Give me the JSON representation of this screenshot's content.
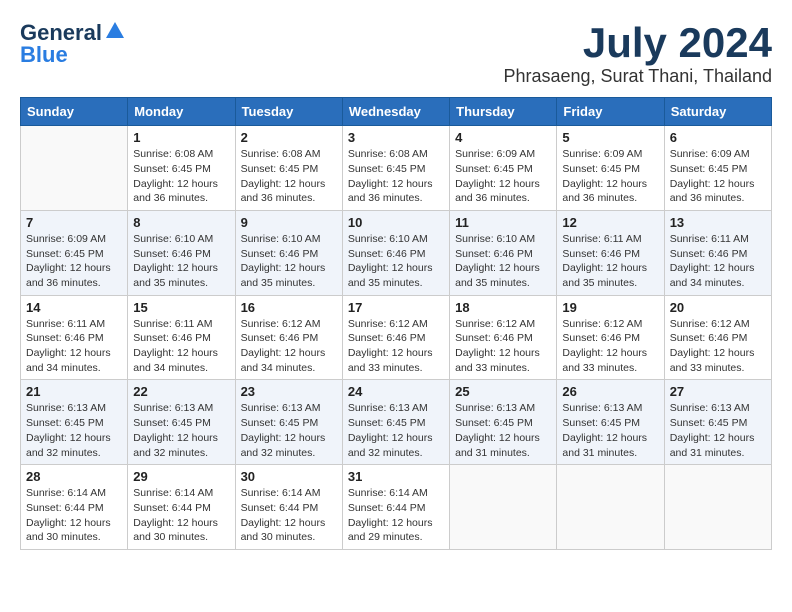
{
  "header": {
    "logo_line1": "General",
    "logo_line2": "Blue",
    "month": "July 2024",
    "location": "Phrasaeng, Surat Thani, Thailand"
  },
  "days_of_week": [
    "Sunday",
    "Monday",
    "Tuesday",
    "Wednesday",
    "Thursday",
    "Friday",
    "Saturday"
  ],
  "weeks": [
    [
      {
        "day": "",
        "info": ""
      },
      {
        "day": "1",
        "info": "Sunrise: 6:08 AM\nSunset: 6:45 PM\nDaylight: 12 hours\nand 36 minutes."
      },
      {
        "day": "2",
        "info": "Sunrise: 6:08 AM\nSunset: 6:45 PM\nDaylight: 12 hours\nand 36 minutes."
      },
      {
        "day": "3",
        "info": "Sunrise: 6:08 AM\nSunset: 6:45 PM\nDaylight: 12 hours\nand 36 minutes."
      },
      {
        "day": "4",
        "info": "Sunrise: 6:09 AM\nSunset: 6:45 PM\nDaylight: 12 hours\nand 36 minutes."
      },
      {
        "day": "5",
        "info": "Sunrise: 6:09 AM\nSunset: 6:45 PM\nDaylight: 12 hours\nand 36 minutes."
      },
      {
        "day": "6",
        "info": "Sunrise: 6:09 AM\nSunset: 6:45 PM\nDaylight: 12 hours\nand 36 minutes."
      }
    ],
    [
      {
        "day": "7",
        "info": "Sunrise: 6:09 AM\nSunset: 6:45 PM\nDaylight: 12 hours\nand 36 minutes."
      },
      {
        "day": "8",
        "info": "Sunrise: 6:10 AM\nSunset: 6:46 PM\nDaylight: 12 hours\nand 35 minutes."
      },
      {
        "day": "9",
        "info": "Sunrise: 6:10 AM\nSunset: 6:46 PM\nDaylight: 12 hours\nand 35 minutes."
      },
      {
        "day": "10",
        "info": "Sunrise: 6:10 AM\nSunset: 6:46 PM\nDaylight: 12 hours\nand 35 minutes."
      },
      {
        "day": "11",
        "info": "Sunrise: 6:10 AM\nSunset: 6:46 PM\nDaylight: 12 hours\nand 35 minutes."
      },
      {
        "day": "12",
        "info": "Sunrise: 6:11 AM\nSunset: 6:46 PM\nDaylight: 12 hours\nand 35 minutes."
      },
      {
        "day": "13",
        "info": "Sunrise: 6:11 AM\nSunset: 6:46 PM\nDaylight: 12 hours\nand 34 minutes."
      }
    ],
    [
      {
        "day": "14",
        "info": "Sunrise: 6:11 AM\nSunset: 6:46 PM\nDaylight: 12 hours\nand 34 minutes."
      },
      {
        "day": "15",
        "info": "Sunrise: 6:11 AM\nSunset: 6:46 PM\nDaylight: 12 hours\nand 34 minutes."
      },
      {
        "day": "16",
        "info": "Sunrise: 6:12 AM\nSunset: 6:46 PM\nDaylight: 12 hours\nand 34 minutes."
      },
      {
        "day": "17",
        "info": "Sunrise: 6:12 AM\nSunset: 6:46 PM\nDaylight: 12 hours\nand 33 minutes."
      },
      {
        "day": "18",
        "info": "Sunrise: 6:12 AM\nSunset: 6:46 PM\nDaylight: 12 hours\nand 33 minutes."
      },
      {
        "day": "19",
        "info": "Sunrise: 6:12 AM\nSunset: 6:46 PM\nDaylight: 12 hours\nand 33 minutes."
      },
      {
        "day": "20",
        "info": "Sunrise: 6:12 AM\nSunset: 6:46 PM\nDaylight: 12 hours\nand 33 minutes."
      }
    ],
    [
      {
        "day": "21",
        "info": "Sunrise: 6:13 AM\nSunset: 6:45 PM\nDaylight: 12 hours\nand 32 minutes."
      },
      {
        "day": "22",
        "info": "Sunrise: 6:13 AM\nSunset: 6:45 PM\nDaylight: 12 hours\nand 32 minutes."
      },
      {
        "day": "23",
        "info": "Sunrise: 6:13 AM\nSunset: 6:45 PM\nDaylight: 12 hours\nand 32 minutes."
      },
      {
        "day": "24",
        "info": "Sunrise: 6:13 AM\nSunset: 6:45 PM\nDaylight: 12 hours\nand 32 minutes."
      },
      {
        "day": "25",
        "info": "Sunrise: 6:13 AM\nSunset: 6:45 PM\nDaylight: 12 hours\nand 31 minutes."
      },
      {
        "day": "26",
        "info": "Sunrise: 6:13 AM\nSunset: 6:45 PM\nDaylight: 12 hours\nand 31 minutes."
      },
      {
        "day": "27",
        "info": "Sunrise: 6:13 AM\nSunset: 6:45 PM\nDaylight: 12 hours\nand 31 minutes."
      }
    ],
    [
      {
        "day": "28",
        "info": "Sunrise: 6:14 AM\nSunset: 6:44 PM\nDaylight: 12 hours\nand 30 minutes."
      },
      {
        "day": "29",
        "info": "Sunrise: 6:14 AM\nSunset: 6:44 PM\nDaylight: 12 hours\nand 30 minutes."
      },
      {
        "day": "30",
        "info": "Sunrise: 6:14 AM\nSunset: 6:44 PM\nDaylight: 12 hours\nand 30 minutes."
      },
      {
        "day": "31",
        "info": "Sunrise: 6:14 AM\nSunset: 6:44 PM\nDaylight: 12 hours\nand 29 minutes."
      },
      {
        "day": "",
        "info": ""
      },
      {
        "day": "",
        "info": ""
      },
      {
        "day": "",
        "info": ""
      }
    ]
  ]
}
